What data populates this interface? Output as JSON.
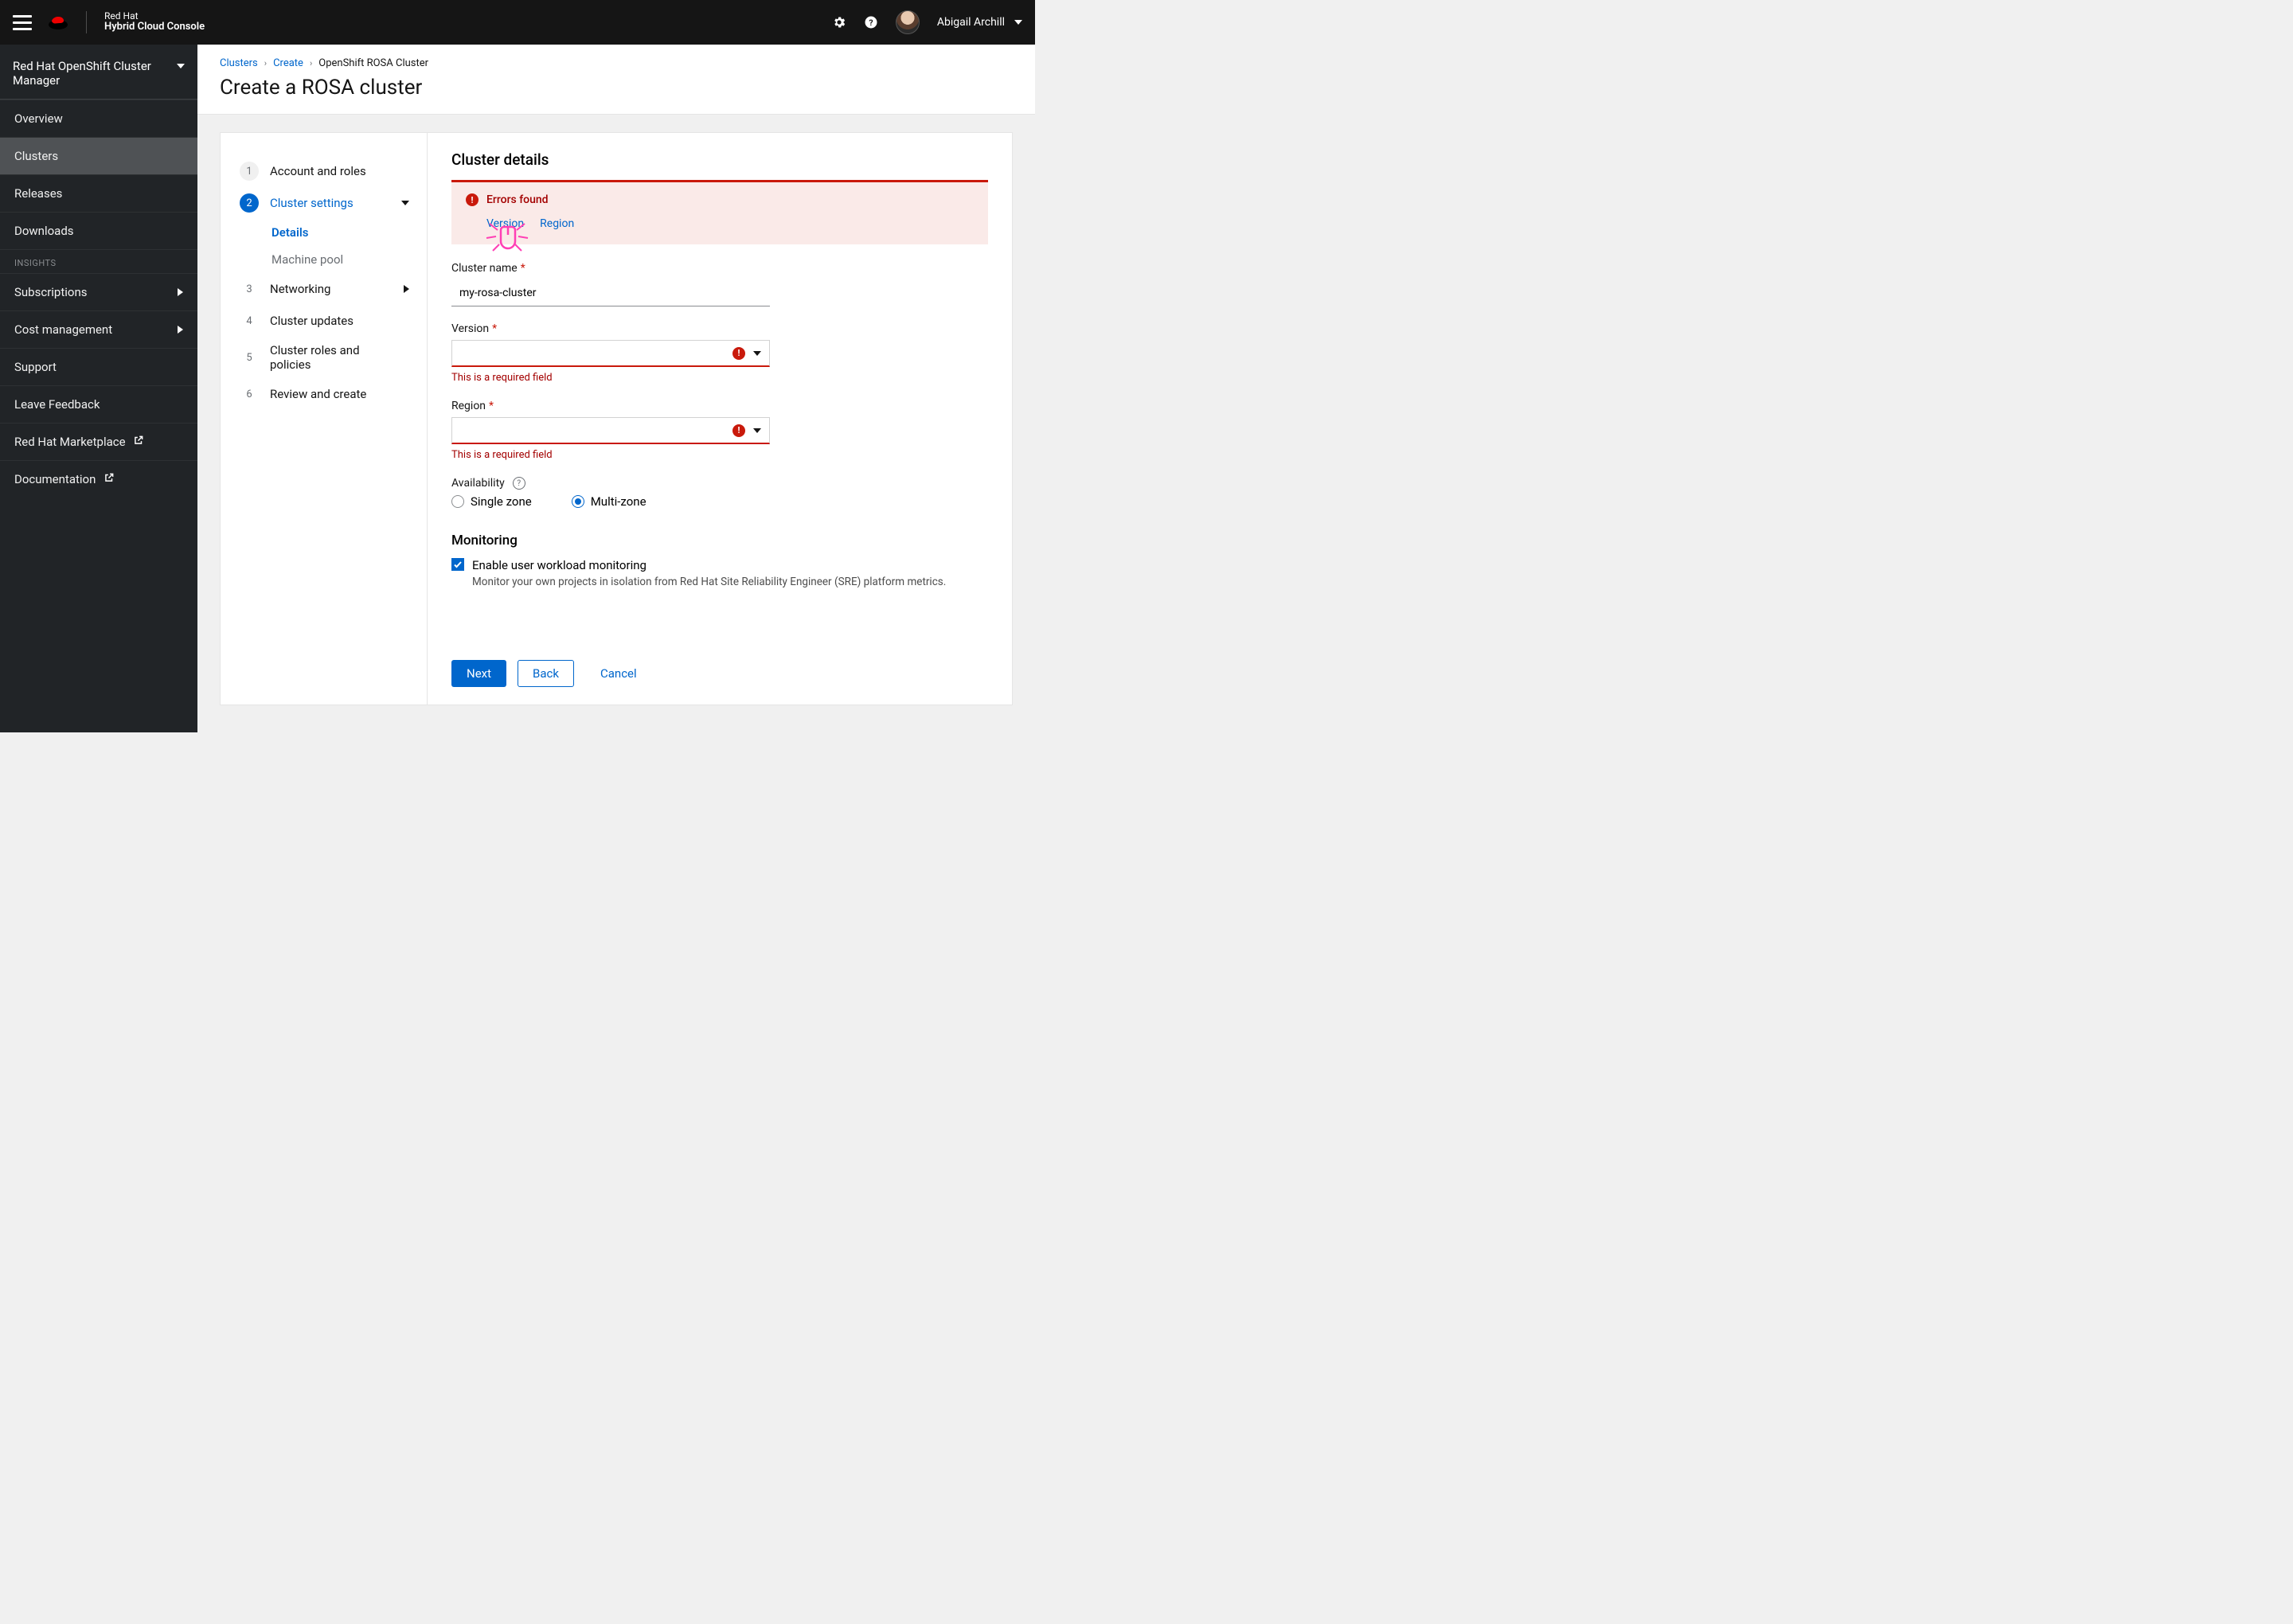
{
  "header": {
    "brand_top": "Red Hat",
    "brand_bottom": "Hybrid Cloud Console",
    "username": "Abigail Archill"
  },
  "sidebar": {
    "context": "Red Hat OpenShift Cluster Manager",
    "items": {
      "overview": "Overview",
      "clusters": "Clusters",
      "releases": "Releases",
      "downloads": "Downloads"
    },
    "section_insights": "INSIGHTS",
    "items2": {
      "subscriptions": "Subscriptions",
      "cost": "Cost management",
      "support": "Support",
      "feedback": "Leave Feedback",
      "marketplace": "Red Hat Marketplace",
      "documentation": "Documentation"
    }
  },
  "breadcrumbs": {
    "a": "Clusters",
    "b": "Create",
    "c": "OpenShift ROSA Cluster"
  },
  "page_title": "Create a ROSA cluster",
  "wizard": {
    "steps": {
      "s1": "Account and roles",
      "s2": "Cluster settings",
      "s2a": "Details",
      "s2b": "Machine pool",
      "s3": "Networking",
      "s4": "Cluster updates",
      "s5": "Cluster roles and policies",
      "s6": "Review and create"
    }
  },
  "form": {
    "section_title": "Cluster details",
    "alert_title": "Errors found",
    "alert_link_version": "Version",
    "alert_link_region": "Region",
    "cluster_name_label": "Cluster name",
    "cluster_name_value": "my-rosa-cluster",
    "version_label": "Version",
    "version_error": "This is a required field",
    "region_label": "Region",
    "region_error": "This is a required field",
    "availability_label": "Availability",
    "avail_single": "Single zone",
    "avail_multi": "Multi-zone",
    "monitoring_title": "Monitoring",
    "monitoring_check": "Enable user workload monitoring",
    "monitoring_desc": "Monitor your own projects in isolation from Red Hat Site Reliability Engineer (SRE) platform metrics."
  },
  "buttons": {
    "next": "Next",
    "back": "Back",
    "cancel": "Cancel"
  }
}
